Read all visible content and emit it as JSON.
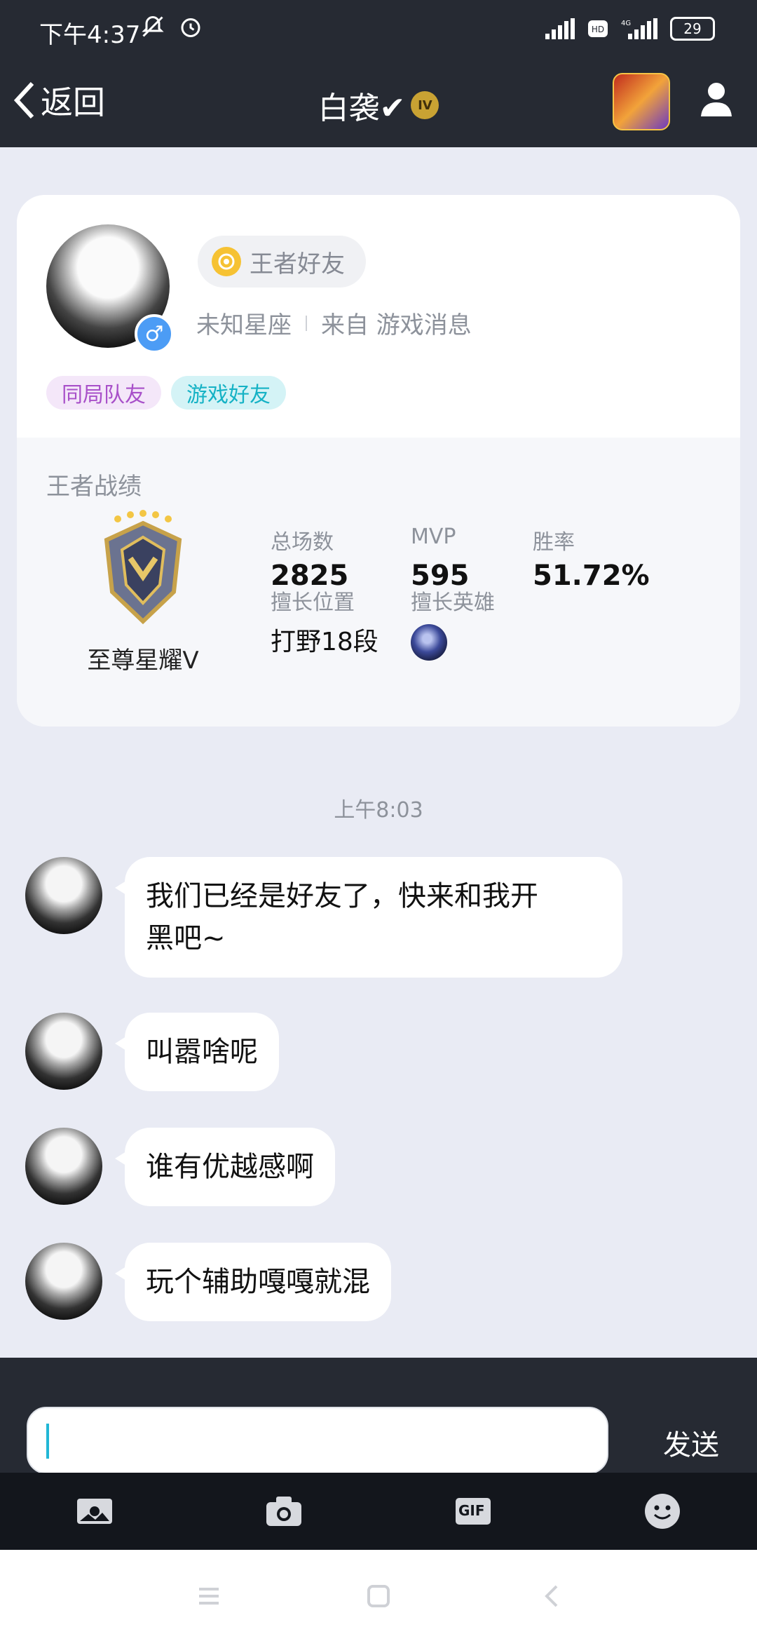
{
  "status_bar": {
    "time": "下午4:37",
    "battery": "29"
  },
  "nav": {
    "back_label": "返回",
    "title": "白袭✔",
    "badge": "IV"
  },
  "profile": {
    "friend_badge": "王者好友",
    "zodiac": "未知星座",
    "source": "来自 游戏消息",
    "gender_symbol": "♂",
    "tags": [
      "同局队友",
      "游戏好友"
    ]
  },
  "stats": {
    "section_title": "王者战绩",
    "rank_name": "至尊星耀V",
    "total_games_label": "总场数",
    "total_games": "2825",
    "mvp_label": "MVP",
    "mvp": "595",
    "win_rate_label": "胜率",
    "win_rate": "51.72%",
    "position_label": "擅长位置",
    "position": "打野18段",
    "hero_label": "擅长英雄"
  },
  "chat": {
    "timestamp": "上午8:03",
    "messages": [
      {
        "line1": "我们已经是好友了，快来和我开",
        "line2": "黑吧~"
      },
      {
        "line1": "叫嚣啥呢"
      },
      {
        "line1": "谁有优越感啊"
      },
      {
        "line1": "玩个辅助嘎嘎就混"
      }
    ]
  },
  "input": {
    "placeholder": "",
    "send_label": "发送"
  },
  "toolbar": {
    "gif_label": "GIF"
  },
  "icons": {
    "back": "chevron-left-icon",
    "profile": "person-icon",
    "image": "image-icon",
    "camera": "camera-icon",
    "gif": "gif-icon",
    "emoji": "emoji-icon"
  },
  "colors": {
    "header_bg": "#262a33",
    "page_bg": "#e9ebf4",
    "accent_cyan": "#21b7d6",
    "gender_blue": "#4c9cf5"
  }
}
